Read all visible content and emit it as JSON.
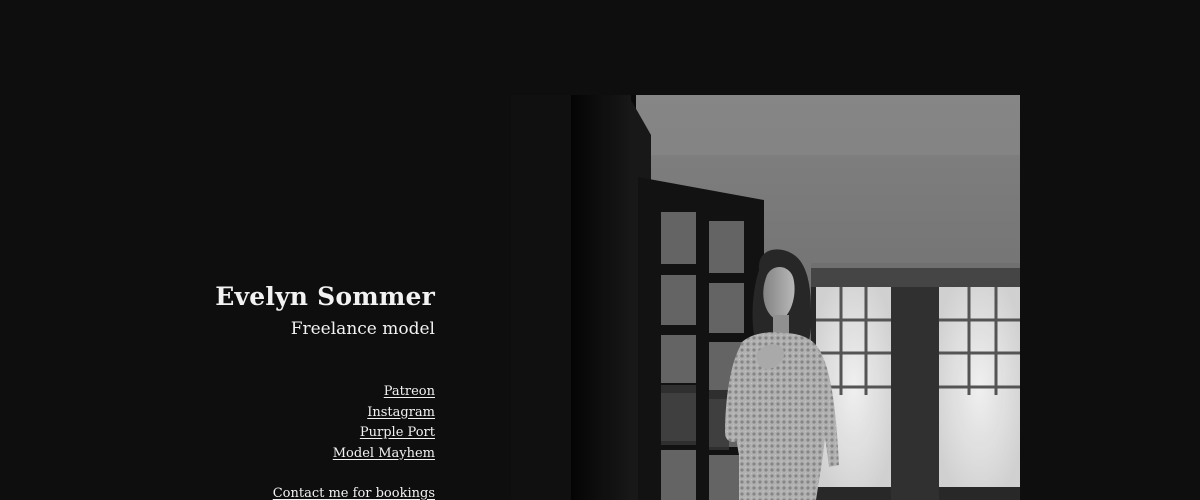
{
  "profile": {
    "name": "Evelyn Sommer",
    "tagline": "Freelance model"
  },
  "links": [
    {
      "label": "Patreon"
    },
    {
      "label": "Instagram"
    },
    {
      "label": "Purple Port"
    },
    {
      "label": "Model Mayhem"
    }
  ],
  "contact": {
    "label": "Contact me for bookings"
  },
  "photo": {
    "alt": "Black and white portrait of a model in a lace bodysuit standing beside a window",
    "style": "monochrome"
  },
  "colors": {
    "background": "#0e0e0f",
    "text": "#f2f2f2"
  }
}
